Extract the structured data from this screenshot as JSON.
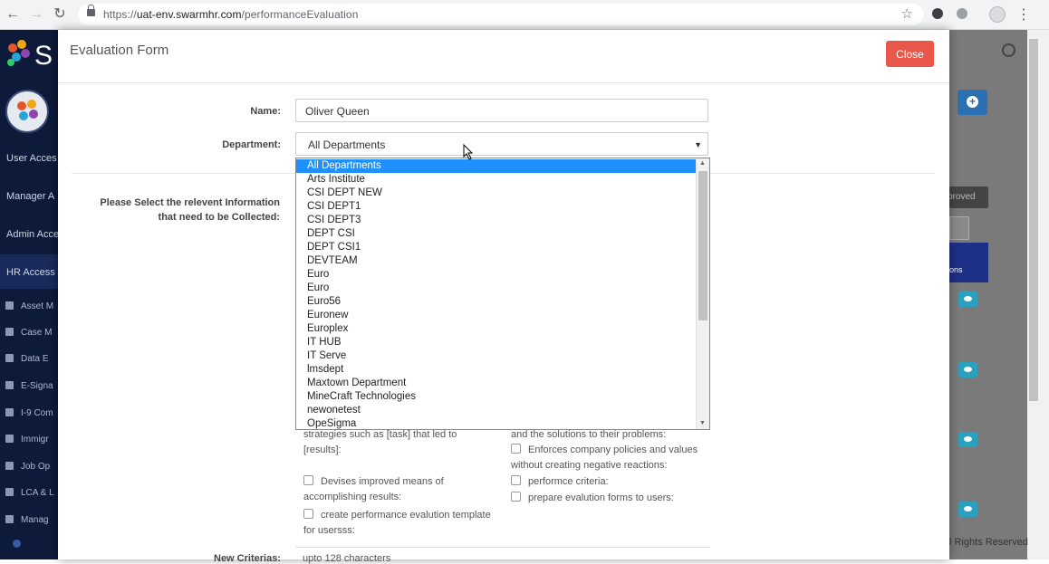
{
  "browser": {
    "url_prefix": "https://",
    "url_host": "uat-env.swarmhr.com",
    "url_path": "/performanceEvaluation"
  },
  "sidebar": {
    "logo_letter": "S",
    "items": [
      "User Acces",
      "Manager A",
      "Admin Acce",
      "HR Access"
    ],
    "subitems": [
      "Asset M",
      "Case M",
      "Data E",
      "E-Signa",
      "I-9 Com",
      "Immigr",
      "Job Op",
      "LCA & L",
      "Manag"
    ]
  },
  "modal": {
    "title": "Evaluation Form",
    "close_label": "Close",
    "name_label": "Name:",
    "name_value": "Oliver Queen",
    "department_label": "Department:",
    "department_value": "All Departments",
    "info_label": "Please Select the relevent Information that need to be Collected:",
    "department_options": [
      "All Departments",
      "Arts Institute",
      "CSI DEPT NEW",
      "CSI DEPT1",
      "CSI DEPT3",
      "DEPT CSI",
      "DEPT CSI1",
      "DEVTEAM",
      "Euro",
      "Euro",
      "Euro56",
      "Euronew",
      "Europlex",
      "IT HUB",
      "IT Serve",
      "lmsdept",
      "Maxtown Department",
      "MineCraft Technologies",
      "newonetest",
      "OpeSigma"
    ],
    "criteria_left": [
      "strategies such as [task] that led to [results]:",
      "Devises improved means of accomplishing results:",
      "create performance evalution template for usersss:"
    ],
    "criteria_right": [
      "and the solutions to their problems:",
      "Enforces company policies and values without creating negative reactions:",
      "performce criteria:",
      "prepare evalution forms to users:"
    ],
    "new_criterias_label": "New Criterias:",
    "new_criterias_placeholder": "upto 128 characters"
  },
  "background": {
    "approved_label": "proved",
    "actions_header": "ons",
    "footer_text": "l Rights Reserved"
  }
}
